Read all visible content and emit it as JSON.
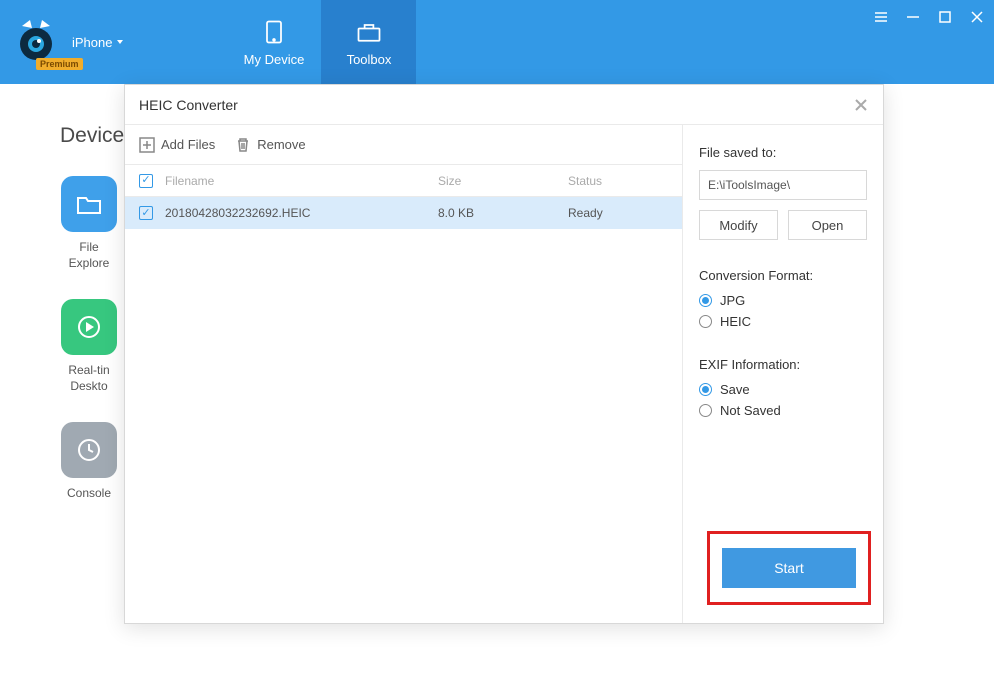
{
  "header": {
    "device_label": "iPhone",
    "premium": "Premium",
    "tabs": [
      {
        "label": "My Device"
      },
      {
        "label": "Toolbox"
      }
    ]
  },
  "background": {
    "title": "Device",
    "items": [
      {
        "label": "File\nExplore",
        "color": "#3fa0ea"
      },
      {
        "label": "Real-tin\nDeskto",
        "color": "#37c77f"
      },
      {
        "label": "Console",
        "color": "#a0a9b2"
      }
    ]
  },
  "dialog": {
    "title": "HEIC Converter",
    "toolbar": {
      "add_files": "Add Files",
      "remove": "Remove"
    },
    "columns": {
      "filename": "Filename",
      "size": "Size",
      "status": "Status"
    },
    "rows": [
      {
        "filename": "20180428032232692.HEIC",
        "size": "8.0 KB",
        "status": "Ready"
      }
    ],
    "right": {
      "saved_to_label": "File saved to:",
      "saved_path": "E:\\iToolsImage\\",
      "modify": "Modify",
      "open": "Open",
      "format_label": "Conversion Format:",
      "format_options": [
        {
          "label": "JPG",
          "selected": true
        },
        {
          "label": "HEIC",
          "selected": false
        }
      ],
      "exif_label": "EXIF Information:",
      "exif_options": [
        {
          "label": "Save",
          "selected": true
        },
        {
          "label": "Not Saved",
          "selected": false
        }
      ],
      "start": "Start"
    }
  }
}
